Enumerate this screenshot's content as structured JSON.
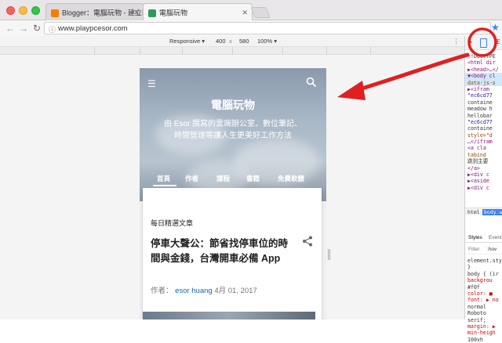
{
  "browser": {
    "tabs": [
      {
        "label": "Blogger：電腦玩物 - 建立新文章",
        "active": false,
        "favicon": "blogger-icon"
      },
      {
        "label": "電腦玩物",
        "active": true,
        "favicon": "site-icon"
      }
    ],
    "url": "www.playpcesor.com"
  },
  "device_toolbar": {
    "mode": "Responsive ▾",
    "width": "400",
    "separator": "x",
    "height": "580",
    "zoom": "100% ▾",
    "menu": "⋮"
  },
  "blog": {
    "title": "電腦玩物",
    "description": "由 Esor 撰寫的雲端辦公室、數位筆記、時間管理等讓人生更美好工作方法",
    "menu": [
      "首頁",
      "作者",
      "課程",
      "書籍",
      "免費軟體"
    ],
    "card": {
      "label": "每日精選文章",
      "title": "停車大聲公：節省找停車位的時間與金錢，台灣開車必備 App",
      "author_prefix": "作者：",
      "author": "esor huang",
      "date": "4月 01, 2017"
    }
  },
  "devtools": {
    "code_lines": [
      "<!DOCTYPE",
      "<html dir",
      "▶<head>…</",
      "▼<body cl",
      "data-js-s",
      "▶<ifram",
      "\"ec6cd77",
      "containe",
      "meadow h",
      "hellobar",
      "\"ec6cd77",
      "containe",
      "style=\"d",
      "…</ifram",
      "<a cla",
      "tabind",
      "跳到主要",
      "</a>",
      "▶<div c",
      "▶<aside",
      "▶<div c"
    ],
    "breadcrumbs": [
      "html",
      "body.w"
    ],
    "style_tabs": [
      "Styles",
      "Event"
    ],
    "filter": [
      "Filter",
      ":hov"
    ],
    "style_lines": [
      "element.sty",
      "}",
      "body {  (ir",
      "backgrou",
      "  #f0f",
      "color: ■",
      "font: ▶ no",
      "  normal",
      "  Roboto",
      "  serif;",
      "margin: ▶",
      "min-heigh",
      "  100vh"
    ]
  },
  "annotation": {
    "highlight_color": "#e02020",
    "target": "device-toolbar-toggle-icon"
  }
}
